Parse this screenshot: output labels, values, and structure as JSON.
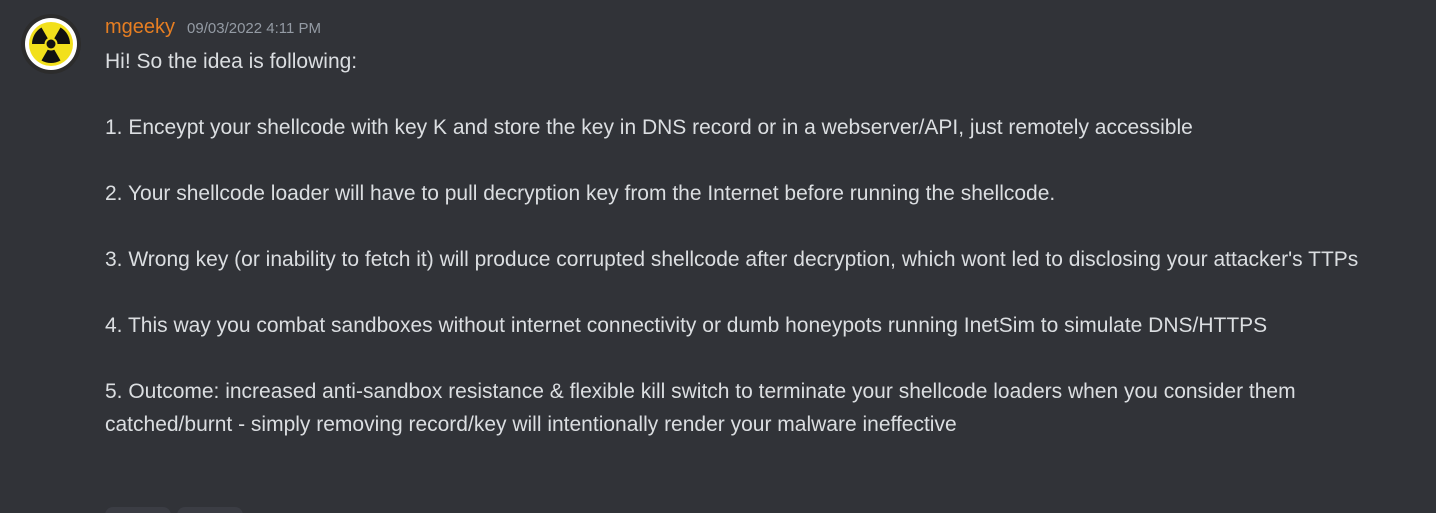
{
  "message": {
    "username": "mgeeky",
    "timestamp": "09/03/2022 4:11 PM",
    "username_color": "#e67e22",
    "avatar_icon": "radiation-icon",
    "lines": [
      "Hi! So the idea is following:",
      "1. Enceypt your shellcode with key K and store the key in DNS record or in a webserver/API, just remotely accessible",
      "2. Your shellcode loader will have to pull decryption key from the Internet before running the shellcode.",
      "3. Wrong key (or inability to fetch it) will produce corrupted shellcode after decryption, which wont led to disclosing your attacker's TTPs",
      "4. This way you combat sandboxes without internet connectivity or dumb honeypots running InetSim to simulate DNS/HTTPS",
      "5. Outcome: increased anti-sandbox resistance & flexible kill switch to terminate your shellcode loaders when you consider them catched/burnt - simply removing record/key will intentionally render your malware ineffective"
    ]
  },
  "colors": {
    "background": "#313338",
    "text": "#dbdee1",
    "timestamp": "#949ba4"
  }
}
